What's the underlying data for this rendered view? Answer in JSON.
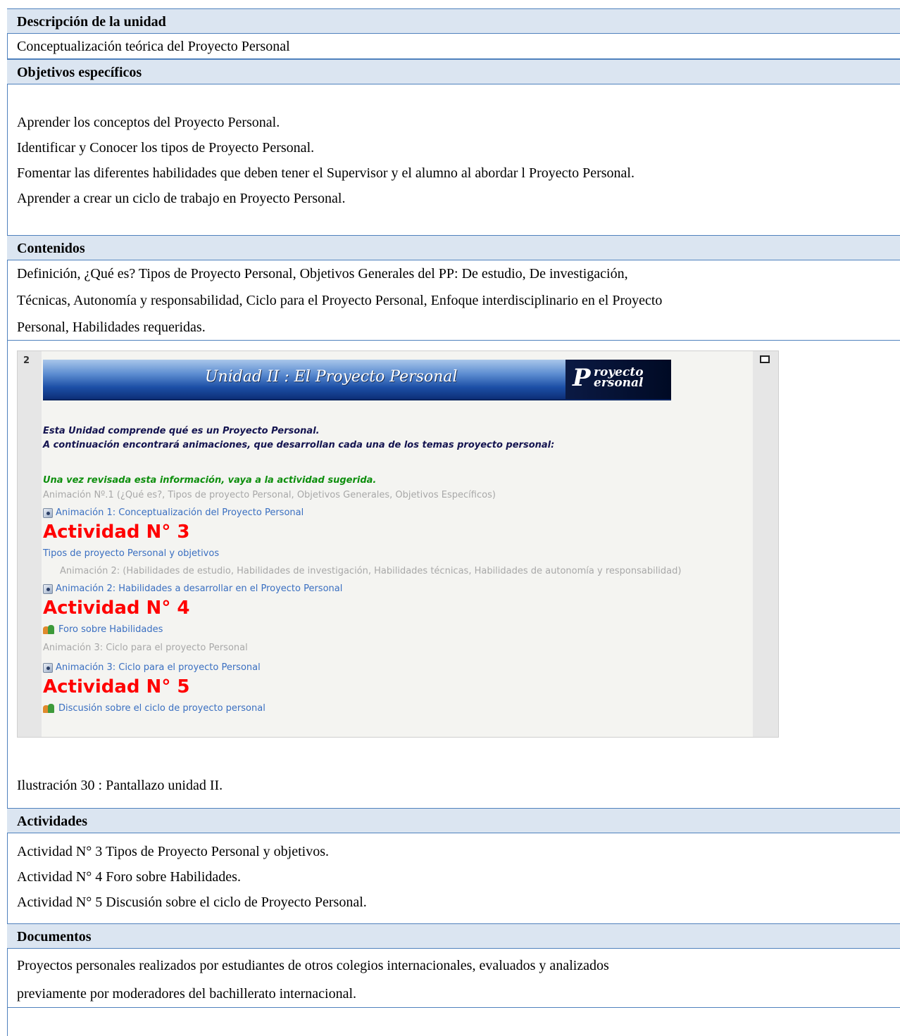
{
  "sections": {
    "descripcion": {
      "heading": "Descripción de la unidad",
      "text": "Conceptualización teórica del  Proyecto Personal"
    },
    "objetivos": {
      "heading": "Objetivos específicos",
      "items": [
        "Aprender los conceptos del  Proyecto Personal.",
        "Identificar y Conocer los tipos de Proyecto Personal.",
        "Fomentar las diferentes habilidades que deben tener el Supervisor y el alumno al abordar l Proyecto Personal.",
        "Aprender a crear un ciclo de trabajo en Proyecto Personal."
      ]
    },
    "contenidos": {
      "heading": "Contenidos",
      "lines": [
        "Definición, ¿Qué es? Tipos de  Proyecto Personal, Objetivos Generales del PP: De estudio, De investigación,",
        "Técnicas, Autonomía y responsabilidad, Ciclo para el  Proyecto Personal, Enfoque interdisciplinario en el  Proyecto",
        "Personal, Habilidades requeridas."
      ]
    },
    "actividades": {
      "heading": "Actividades",
      "items": [
        "Actividad N° 3 Tipos de  Proyecto Personal y objetivos.",
        "Actividad N° 4 Foro sobre Habilidades.",
        "Actividad N° 5 Discusión sobre el ciclo de  Proyecto Personal."
      ]
    },
    "documentos": {
      "heading": "Documentos",
      "lines": [
        "Proyectos personales realizados por estudiantes de otros colegios internacionales, evaluados y analizados",
        "previamente por moderadores del bachillerato internacional."
      ]
    }
  },
  "caption": "Ilustración 30 : Pantallazo unidad II.",
  "screenshot": {
    "section_number": "2",
    "banner_title": "Unidad II : El Proyecto Personal",
    "logo": {
      "initial": "P",
      "line1": "royecto",
      "line2": "ersonal"
    },
    "intro1": "Esta Unidad comprende qué es un Proyecto Personal.",
    "intro2": "A continuación encontrará animaciones, que desarrollan cada una de los temas proyecto personal:",
    "notice": "Una vez revisada esta información, vaya a la actividad sugerida.",
    "anim1_desc": "Animación Nº.1 (¿Qué es?, Tipos de proyecto Personal, Objetivos Generales, Objetivos Específicos)",
    "anim1_link": "Animación 1: Conceptualización del Proyecto Personal",
    "act3": "Actividad N° 3",
    "act3_link": "Tipos de proyecto Personal y objetivos",
    "anim2_desc": "Animación 2: (Habilidades de estudio, Habilidades de investigación, Habilidades técnicas, Habilidades de autonomía y responsabilidad)",
    "anim2_link": "Animación 2: Habilidades a desarrollar en el Proyecto Personal",
    "act4": "Actividad N° 4",
    "act4_link": "Foro sobre Habilidades",
    "anim3_desc": "Animación 3: Ciclo para el proyecto Personal",
    "anim3_link": "Animación 3: Ciclo para el proyecto Personal",
    "act5": "Actividad N° 5",
    "act5_link": "Discusión sobre el ciclo de proyecto personal"
  }
}
